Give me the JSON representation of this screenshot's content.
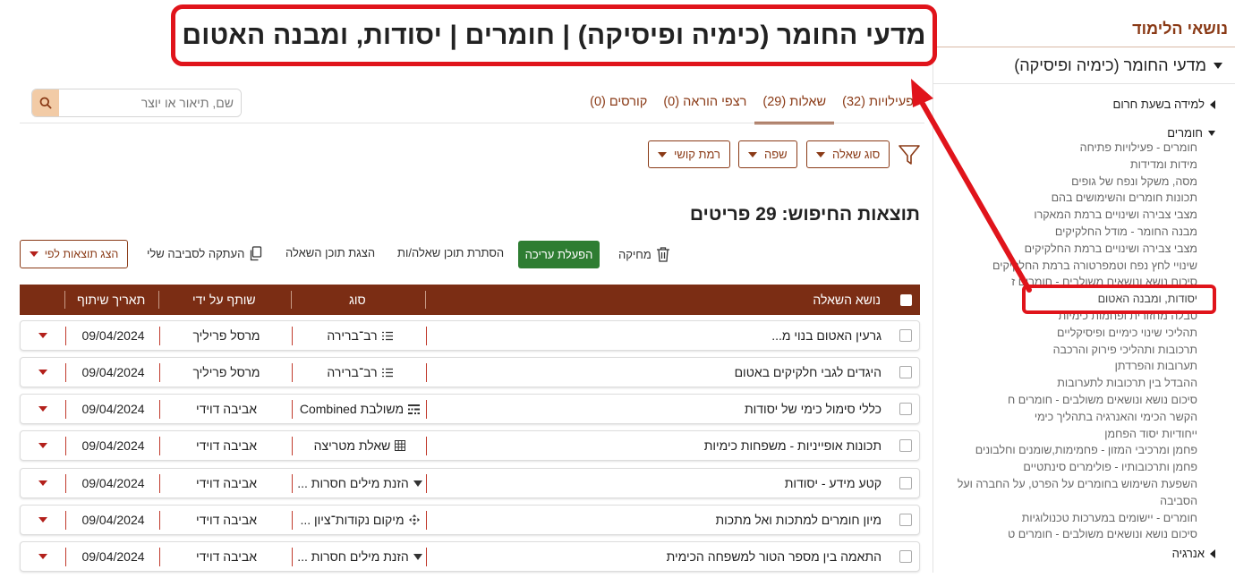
{
  "page_title": "מדעי החומר (כימיה ופיסיקה) | חומרים | יסודות, ומבנה האטום",
  "sidebar": {
    "title": "נושאי הלימוד",
    "subject": "מדעי החומר (כימיה ופיסיקה)",
    "categories": [
      {
        "label": "למידה בשעת חרום"
      },
      {
        "label": "חומרים"
      },
      {
        "label": "אנרגיה"
      }
    ],
    "items": [
      "חומרים - פעילויות פתיחה",
      "מידות ומדידות",
      "מסה, משקל ונפח של גופים",
      "תכונות חומרים והשימושים בהם",
      "מצבי צבירה ושינויים ברמת המאקרו",
      "מבנה החומר - מודל החלקיקים",
      "מצבי צבירה ושינויים ברמת החלקיקים",
      "שינויי לחץ נפח וטמפרטורה ברמת החלקיקים",
      "סיכום נושא ונושאים משולבים - חומרים ז",
      "יסודות, ומבנה האטום",
      "טבלה מחזורית ופחמות כימיות",
      "תהליכי שינוי כימיים ופיסיקליים",
      "תרכובות ותהליכי פירוק והרכבה",
      "תערובות והפרדתן",
      "ההבדל בין תרכובות לתערובות",
      "סיכום נושא ונושאים משולבים - חומרים ח",
      "הקשר הכימי והאנרגיה בתהליך כימי",
      "ייחודיות יסוד הפחמן",
      "פחמן ומרכיבי המזון - פחמימות,שומנים וחלבונים",
      "פחמן ותרכובותיו - פולימרים סינתטיים",
      "השפעת השימוש בחומרים על הפרט, על החברה ועל הסביבה",
      "חומרים - יישומים במערכות טכנולוגיות",
      "סיכום נושא ונושאים משולבים - חומרים ט"
    ]
  },
  "search": {
    "placeholder": "שם, תיאור או יוצר",
    "value": ""
  },
  "tabs": [
    {
      "label": "פעילויות (32)"
    },
    {
      "label": "שאלות (29)"
    },
    {
      "label": "רצפי הוראה (0)"
    },
    {
      "label": "קורסים (0)"
    }
  ],
  "filters": [
    {
      "label": "סוג שאלה"
    },
    {
      "label": "שפה"
    },
    {
      "label": "רמת קושי"
    }
  ],
  "results_label": "תוצאות החיפוש: 29 פריטים",
  "toolbar": {
    "delete": "מחיקה",
    "edit": "הפעלת עריכה",
    "hide_content": "הסתרת תוכן שאלה/ות",
    "show_content": "הצגת תוכן השאלה",
    "copy": "העתקה לסביבה שלי",
    "show_by": "הצג תוצאות לפי"
  },
  "table": {
    "headers": {
      "subject": "נושא השאלה",
      "type": "סוג",
      "shared_by": "שותף על ידי",
      "date": "תאריך שיתוף"
    },
    "rows": [
      {
        "subject": "גרעין האטום בנוי מ...",
        "type": "רב־ברירה",
        "type_icon": "list-icon",
        "shared_by": "מרסל פריליך",
        "date": "09/04/2024"
      },
      {
        "subject": "היגדים לגבי חלקיקים באטום",
        "type": "רב־ברירה",
        "type_icon": "list-icon",
        "shared_by": "מרסל פריליך",
        "date": "09/04/2024"
      },
      {
        "subject": "כללי סימול כימי של יסודות",
        "type": "משולבת Combined",
        "type_icon": "combined-icon",
        "shared_by": "אביבה דוידי",
        "date": "09/04/2024"
      },
      {
        "subject": "תכונות אופייניות - משפחות כימיות",
        "type": "שאלת מטריצה",
        "type_icon": "matrix-icon",
        "shared_by": "אביבה דוידי",
        "date": "09/04/2024"
      },
      {
        "subject": "קטע מידע - יסודות",
        "type": "הזנת מילים חסרות ...",
        "type_icon": "dropdown-icon",
        "shared_by": "אביבה דוידי",
        "date": "09/04/2024"
      },
      {
        "subject": "מיון חומרים למתכות ואל מתכות",
        "type": "מיקום נקודות־ציון ...",
        "type_icon": "move-icon",
        "shared_by": "אביבה דוידי",
        "date": "09/04/2024"
      },
      {
        "subject": "התאמה בין מספר הטור למשפחה הכימית",
        "type": "הזנת מילים חסרות ...",
        "type_icon": "dropdown-icon",
        "shared_by": "אביבה דוידי",
        "date": "09/04/2024"
      }
    ]
  },
  "colors": {
    "accent": "#8a3a16",
    "header_bg": "#7b2d14",
    "edit_green": "#2e7d32",
    "annotation_red": "#e0141b"
  }
}
